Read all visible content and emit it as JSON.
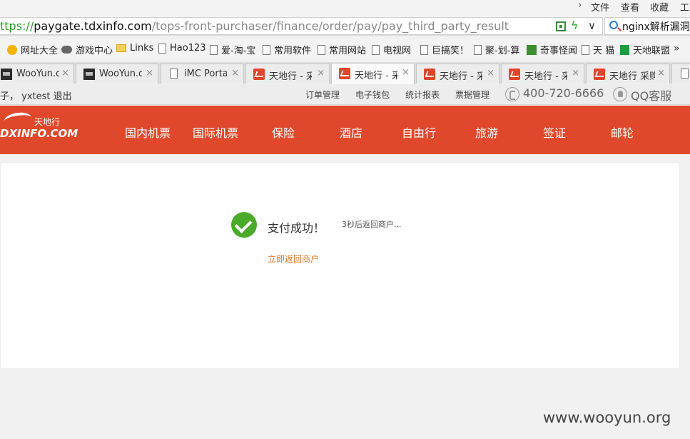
{
  "browser": {
    "menu": [
      "文件",
      "查看",
      "收藏",
      "工"
    ],
    "url": {
      "scheme": "https://",
      "scheme_visible": "ttps://",
      "host": "paygate.tdxinfo.com",
      "path": "/tops-front-purchaser/finance/order/pay/pay_third_party_result"
    },
    "search_text": "nginx解析漏洞",
    "bookmarks": [
      {
        "label": "网址大全",
        "icon": "nav-icon"
      },
      {
        "label": "游戏中心",
        "icon": "game-icon"
      },
      {
        "label": "Links",
        "icon": "folder-icon"
      },
      {
        "label": "Hao123",
        "icon": "page-icon"
      },
      {
        "label": "爱-淘-宝",
        "icon": "page-icon"
      },
      {
        "label": "常用软件",
        "icon": "page-icon"
      },
      {
        "label": "常用网站",
        "icon": "page-icon"
      },
      {
        "label": "电视网",
        "icon": "page-icon"
      },
      {
        "label": "巨搞笑！",
        "icon": "page-icon"
      },
      {
        "label": "聚-划-算",
        "icon": "page-icon"
      },
      {
        "label": "奇事怪闻",
        "icon": "cat-icon"
      },
      {
        "label": "天 猫",
        "icon": "page-icon"
      },
      {
        "label": "天地联盟",
        "icon": "league-icon"
      }
    ],
    "tabs": [
      {
        "label": "WooYun.o",
        "favicon": "wooyun-icon",
        "active": false
      },
      {
        "label": "WooYun.o",
        "favicon": "wooyun-icon",
        "active": false
      },
      {
        "label": "iMC Portal",
        "favicon": "page-icon",
        "active": false
      },
      {
        "label": "天地行 - 采",
        "favicon": "tdx-icon",
        "active": false
      },
      {
        "label": "天地行 - 采",
        "favicon": "tdx-icon",
        "active": true
      },
      {
        "label": "天地行 - 采",
        "favicon": "tdx-icon",
        "active": false
      },
      {
        "label": "天地行 - 采",
        "favicon": "tdx-icon",
        "active": false
      },
      {
        "label": "天地行 采购",
        "favicon": "tdx-icon",
        "active": false
      }
    ]
  },
  "site": {
    "user_bar": "子， yxtest 退出",
    "utility_links": [
      "订单管理",
      "电子钱包",
      "统计报表",
      "票据管理"
    ],
    "phone": "400-720-6666",
    "qq_service": "QQ客服",
    "logo_cn": "天地行",
    "logo_en": "DXINFO.COM",
    "nav": [
      "国内机票",
      "国际机票",
      "保险",
      "酒店",
      "自由行",
      "旅游",
      "签证",
      "邮轮"
    ],
    "accent_color": "#e0482b"
  },
  "result": {
    "status": "支付成功！",
    "countdown": "3秒后返回商户...",
    "return_link": "立即返回商户"
  },
  "watermark": "www.wooyun.org"
}
